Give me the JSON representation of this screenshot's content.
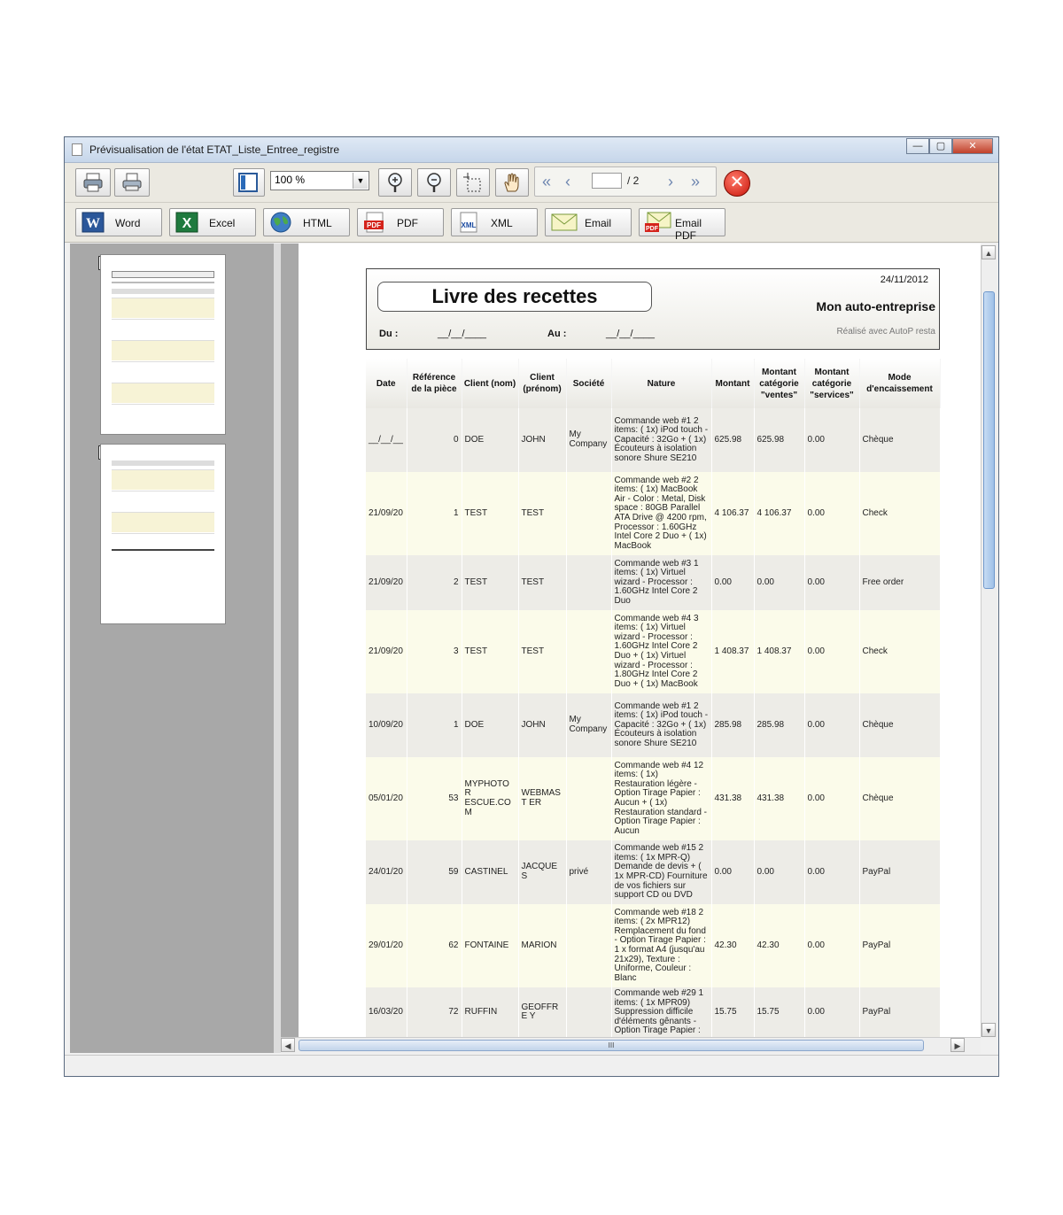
{
  "window": {
    "title": "Prévisualisation de l'état ETAT_Liste_Entree_registre",
    "buttons": {
      "minimize": "—",
      "maximize": "▢",
      "close": "✕"
    }
  },
  "toolbar": {
    "zoom_value": "100 %",
    "page_total": "/ 2",
    "icons": [
      "printer-icon",
      "quick-print-icon",
      "thumbnail-toggle-icon",
      "zoom-in-icon",
      "zoom-out-icon",
      "select-area-icon",
      "hand-pan-icon",
      "first-page-icon",
      "previous-page-icon",
      "next-page-icon",
      "last-page-icon",
      "close-preview-icon"
    ]
  },
  "export": {
    "word": "Word",
    "excel": "Excel",
    "html": "HTML",
    "pdf": "PDF",
    "xml": "XML",
    "email": "Email",
    "email_pdf": "Email PDF",
    "pdf_badge": "PDF",
    "xml_badge": "XML"
  },
  "thumbnails": [
    {
      "number": "1"
    },
    {
      "number": "2"
    }
  ],
  "report": {
    "title": "Livre des recettes",
    "date": "24/11/2012",
    "company": "Mon auto-entreprise",
    "made_with": "Réalisé avec AutoP resta",
    "du_label": "Du :",
    "du_value": "__/__/____",
    "au_label": "Au :",
    "au_value": "__/__/____",
    "columns": [
      "Date",
      "Référence de la pièce",
      "Client (nom)",
      "Client (prénom)",
      "Société",
      "Nature",
      "Montant",
      "Montant catégorie \"ventes\"",
      "Montant catégorie \"services\"",
      "Mode d'encaissement"
    ],
    "rows": [
      {
        "date": "__/__/__",
        "ref": "0",
        "nom": "DOE",
        "prenom": "JOHN",
        "societe": "My Company",
        "nature": "Commande web #1 2 items: ( 1x) iPod touch - Capacité : 32Go + ( 1x) Écouteurs à isolation sonore Shure SE210",
        "montant": "625.98",
        "ventes": "625.98",
        "services": "0.00",
        "mode": "Chèque"
      },
      {
        "date": "21/09/20",
        "ref": "1",
        "nom": "TEST",
        "prenom": "TEST",
        "societe": "",
        "nature": "Commande web #2 2 items: ( 1x) MacBook Air - Color : Metal, Disk space : 80GB Parallel ATA Drive @ 4200 rpm, Processor : 1.60GHz Intel Core 2 Duo + ( 1x) MacBook",
        "montant": "4 106.37",
        "ventes": "4 106.37",
        "services": "0.00",
        "mode": "Check"
      },
      {
        "date": "21/09/20",
        "ref": "2",
        "nom": "TEST",
        "prenom": "TEST",
        "societe": "",
        "nature": "Commande web #3 1 items: ( 1x) Virtuel wizard - Processor : 1.60GHz Intel Core 2 Duo",
        "montant": "0.00",
        "ventes": "0.00",
        "services": "0.00",
        "mode": "Free order"
      },
      {
        "date": "21/09/20",
        "ref": "3",
        "nom": "TEST",
        "prenom": "TEST",
        "societe": "",
        "nature": "Commande web #4 3 items: ( 1x) Virtuel wizard - Processor : 1.60GHz Intel Core 2 Duo + ( 1x) Virtuel wizard - Processor : 1.80GHz Intel Core 2 Duo + ( 1x) MacBook",
        "montant": "1 408.37",
        "ventes": "1 408.37",
        "services": "0.00",
        "mode": "Check"
      },
      {
        "date": "10/09/20",
        "ref": "1",
        "nom": "DOE",
        "prenom": "JOHN",
        "societe": "My Company",
        "nature": "Commande web #1 2 items: ( 1x) iPod touch - Capacité : 32Go + ( 1x) Écouteurs à isolation sonore Shure SE210",
        "montant": "285.98",
        "ventes": "285.98",
        "services": "0.00",
        "mode": "Chèque"
      },
      {
        "date": "05/01/20",
        "ref": "53",
        "nom": "MYPHOTOR ESCUE.COM",
        "prenom": "WEBMAST ER",
        "societe": "",
        "nature": "Commande web #4 12 items: ( 1x) Restauration légère - Option Tirage Papier : Aucun + ( 1x) Restauration standard - Option Tirage Papier : Aucun",
        "montant": "431.38",
        "ventes": "431.38",
        "services": "0.00",
        "mode": "Chèque"
      },
      {
        "date": "24/01/20",
        "ref": "59",
        "nom": "CASTINEL",
        "prenom": "JACQUES",
        "societe": "privé",
        "nature": "Commande web #15 2 items: ( 1x MPR-Q) Demande de devis + ( 1x MPR-CD) Fourniture de vos fichiers sur support CD ou DVD",
        "montant": "0.00",
        "ventes": "0.00",
        "services": "0.00",
        "mode": "PayPal"
      },
      {
        "date": "29/01/20",
        "ref": "62",
        "nom": "FONTAINE",
        "prenom": "MARION",
        "societe": "",
        "nature": "Commande web #18 2 items: ( 2x MPR12) Remplacement du fond - Option Tirage Papier : 1 x format A4 (jusqu'au 21x29), Texture : Uniforme, Couleur : Blanc",
        "montant": "42.30",
        "ventes": "42.30",
        "services": "0.00",
        "mode": "PayPal"
      },
      {
        "date": "16/03/20",
        "ref": "72",
        "nom": "RUFFIN",
        "prenom": "GEOFFRE Y",
        "societe": "",
        "nature": "Commande web #29 1 items: ( 1x MPR09) Suppression difficile d'éléments gênants - Option Tirage Papier :",
        "montant": "15.75",
        "ventes": "15.75",
        "services": "0.00",
        "mode": "PayPal"
      }
    ]
  },
  "scrollbar": {
    "grip": "III"
  }
}
